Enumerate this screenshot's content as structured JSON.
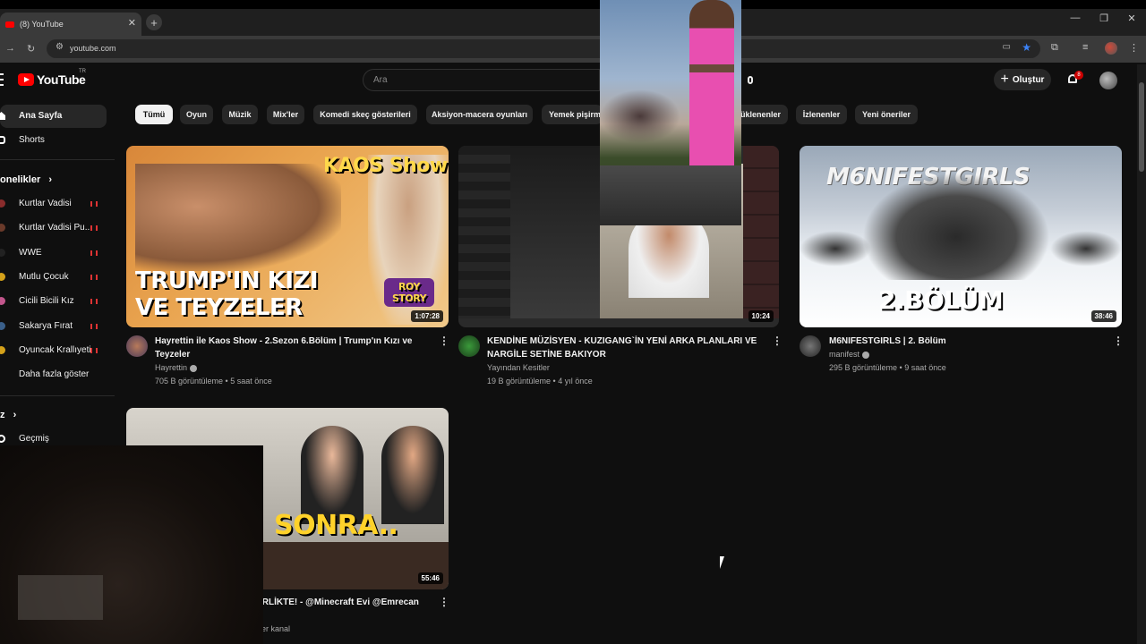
{
  "browser": {
    "tab_title": "(8) YouTube",
    "tab_close": "✕",
    "new_tab": "+",
    "url": "youtube.com",
    "window_controls": [
      "—",
      "❐",
      "✕"
    ]
  },
  "header": {
    "logo_text": "YouTube",
    "region": "TR",
    "search_placeholder": "Ara",
    "create_label": "Oluştur",
    "notification_count": "8"
  },
  "sidebar": {
    "home": "Ana Sayfa",
    "shorts": "Shorts",
    "subs_heading": "onelikler",
    "subs_arrow": "›",
    "channels": [
      {
        "label": "Kurtlar Vadisi",
        "color": "#8a2c2c"
      },
      {
        "label": "Kurtlar Vadisi Pu...",
        "color": "#6a3a2a"
      },
      {
        "label": "WWE",
        "color": "#222"
      },
      {
        "label": "Mutlu Çocuk",
        "color": "#d4a11a"
      },
      {
        "label": "Cicili Bicili Kız",
        "color": "#c2568c"
      },
      {
        "label": "Sakarya Fırat",
        "color": "#3a5f8a"
      },
      {
        "label": "Oyuncak Krallıyeti",
        "color": "#d4a11a"
      }
    ],
    "show_more": "Daha fazla göster",
    "you_heading": "z",
    "you_arrow": "›",
    "history": "Geçmiş"
  },
  "chips": [
    {
      "label": "Tümü",
      "active": true
    },
    {
      "label": "Oyun"
    },
    {
      "label": "Müzik"
    },
    {
      "label": "Mix'ler"
    },
    {
      "label": "Komedi skeç gösterileri"
    },
    {
      "label": "Aksiyon-macera oyunları"
    },
    {
      "label": "Yemek pişirm"
    },
    {
      "label": "üklenenler"
    },
    {
      "label": "İzlenenler"
    },
    {
      "label": "Yeni öneriler"
    }
  ],
  "videos": [
    {
      "title_line1": "Hayrettin ile Kaos Show - 2.Sezon 6.Bölüm | Trump'ın Kızı ve",
      "title_line2": "Teyzeler",
      "channel": "Hayrettin",
      "meta": "705 B görüntüleme • 5 saat önce",
      "duration": "1:07:28",
      "thumb_line1": "TRUMP'IN KIZI",
      "thumb_line2": "VE TEYZELER",
      "thumb_badge": "ROY STORY",
      "thumb_logo": "KAOS Show"
    },
    {
      "title_line1": "KENDİNE MÜZİSYEN - KUZIGANG`İN YENİ ARKA PLANLARI VE",
      "title_line2": "NARGİLE SETİNE BAKIYOR",
      "channel": "Yayından Kesitler",
      "meta": "19 B görüntüleme • 4 yıl önce",
      "duration": "10:24"
    },
    {
      "title_line1": "M6NIFESTGIRLS | 2. Bölüm",
      "channel": "manifest",
      "meta": "295 B görüntüleme • 9 saat önce",
      "duration": "38:46",
      "thumb_text": "2.BÖLÜM",
      "thumb_logo": "M6NIFESTGIRLS"
    },
    {
      "title_line1": "İRLİKTE! - @Minecraft Evi @Emrecan",
      "channel": "ler kanal",
      "duration": "55:46",
      "thumb_text": "SONRA.."
    }
  ],
  "kebab": "⋮"
}
